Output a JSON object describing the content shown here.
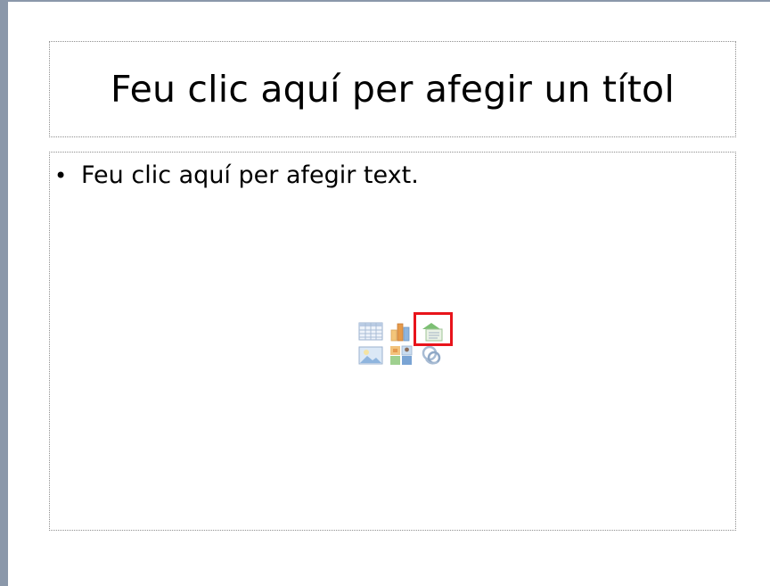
{
  "slide": {
    "title_placeholder": "Feu clic aquí per afegir un títol",
    "body_placeholder": "Feu clic aquí per afegir text.",
    "bullet_glyph": "•"
  },
  "content_icons": [
    {
      "name": "insert-table-icon"
    },
    {
      "name": "insert-chart-icon"
    },
    {
      "name": "insert-smartart-icon",
      "highlighted": true
    },
    {
      "name": "insert-picture-icon"
    },
    {
      "name": "insert-clip-art-icon"
    },
    {
      "name": "insert-media-clip-icon"
    }
  ],
  "colors": {
    "highlight": "#e8141b",
    "frame": "#8b98aa",
    "placeholder_border": "#8f8f8f"
  }
}
